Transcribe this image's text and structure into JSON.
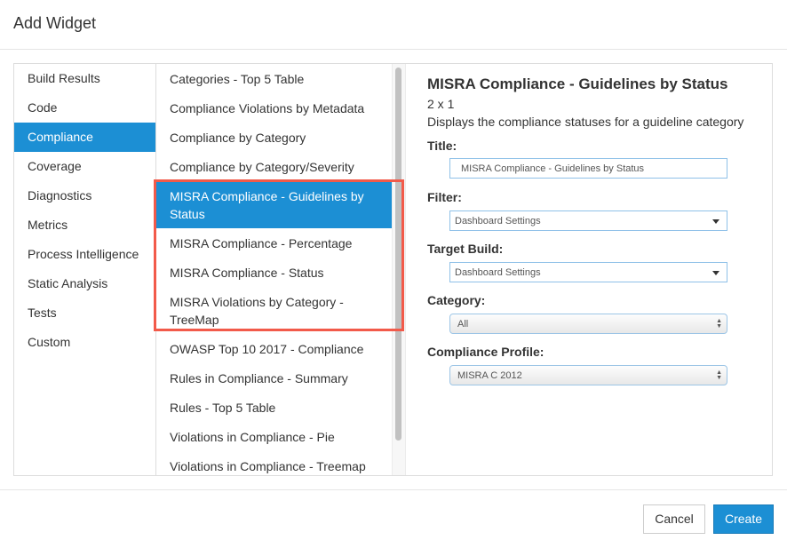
{
  "dialog": {
    "title": "Add Widget"
  },
  "categories": [
    {
      "label": "Build Results"
    },
    {
      "label": "Code"
    },
    {
      "label": "Compliance",
      "selected": true
    },
    {
      "label": "Coverage"
    },
    {
      "label": "Diagnostics"
    },
    {
      "label": "Metrics"
    },
    {
      "label": "Process Intelligence"
    },
    {
      "label": "Static Analysis"
    },
    {
      "label": "Tests"
    },
    {
      "label": "Custom"
    }
  ],
  "widgets": [
    {
      "label": "Categories - Top 5 Table"
    },
    {
      "label": "Compliance Violations by Metadata"
    },
    {
      "label": "Compliance by Category"
    },
    {
      "label": "Compliance by Category/Severity"
    },
    {
      "label": "MISRA Compliance - Guidelines by Status",
      "selected": true
    },
    {
      "label": "MISRA Compliance - Percentage"
    },
    {
      "label": "MISRA Compliance - Status"
    },
    {
      "label": "MISRA Violations by Category - TreeMap"
    },
    {
      "label": "OWASP Top 10 2017 - Compliance"
    },
    {
      "label": "Rules in Compliance - Summary"
    },
    {
      "label": "Rules - Top 5 Table"
    },
    {
      "label": "Violations in Compliance - Pie"
    },
    {
      "label": "Violations in Compliance - Treemap"
    }
  ],
  "detail": {
    "name": "MISRA Compliance - Guidelines by Status",
    "size": "2 x 1",
    "description": "Displays the compliance statuses for a guideline category",
    "title_label": "Title:",
    "title_value": "MISRA Compliance - Guidelines by Status",
    "filter_label": "Filter:",
    "filter_value": "Dashboard Settings",
    "target_build_label": "Target Build:",
    "target_build_value": "Dashboard Settings",
    "category_label": "Category:",
    "category_value": "All",
    "profile_label": "Compliance Profile:",
    "profile_value": "MISRA C 2012"
  },
  "footer": {
    "cancel_label": "Cancel",
    "create_label": "Create"
  },
  "colors": {
    "accent": "#1c8fd4",
    "highlight_border": "#f25a4a"
  }
}
